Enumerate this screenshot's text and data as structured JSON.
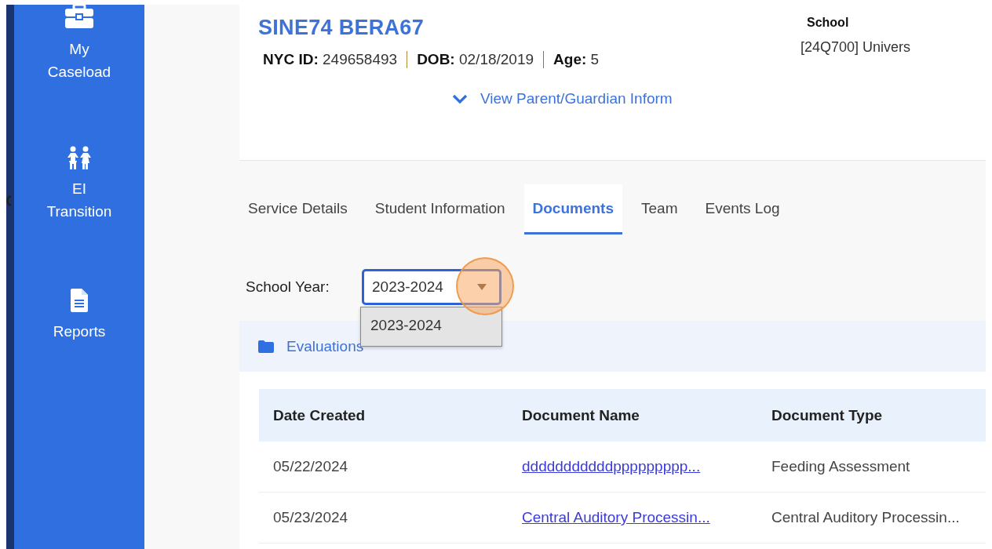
{
  "sidebar": {
    "items": [
      {
        "kind": "briefcase",
        "label_lines": [
          "My",
          "Caseload"
        ]
      },
      {
        "kind": "children",
        "label_lines": [
          "EI",
          "Transition"
        ]
      },
      {
        "kind": "report",
        "label_lines": [
          "Reports"
        ]
      }
    ]
  },
  "student": {
    "name": "SINE74 BERA67",
    "facts": [
      {
        "label": "NYC ID:",
        "value": "249658493"
      },
      {
        "label": "DOB:",
        "value": "02/18/2019"
      },
      {
        "label": "Age:",
        "value": "5"
      }
    ],
    "school_label": "School",
    "school_value": "[24Q700] Univers",
    "guardian_link": "View Parent/Guardian Inform"
  },
  "tabs": [
    {
      "label": "Service Details",
      "selected": false
    },
    {
      "label": "Student Information",
      "selected": false
    },
    {
      "label": "Documents",
      "selected": true
    },
    {
      "label": "Team",
      "selected": false
    },
    {
      "label": "Events Log",
      "selected": false
    }
  ],
  "school_year": {
    "label": "School Year:",
    "value": "2023-2024",
    "expanded": true,
    "options": [
      "2023-2024"
    ]
  },
  "section": {
    "title": "Evaluations"
  },
  "table": {
    "columns": [
      "Date Created",
      "Document Name",
      "Document Type"
    ],
    "rows": [
      [
        "05/22/2024",
        "dddddddddddppppppppp...",
        "Feeding Assessment"
      ],
      [
        "05/23/2024",
        "Central Auditory Processin...",
        "Central Auditory Processin..."
      ]
    ]
  }
}
